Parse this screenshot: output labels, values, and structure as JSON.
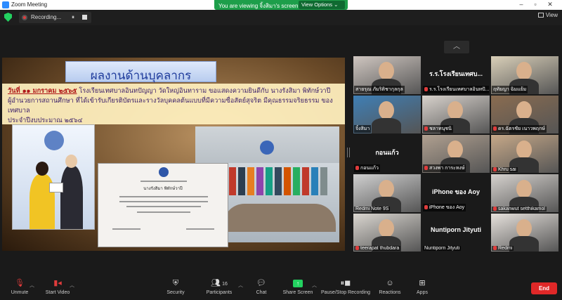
{
  "window": {
    "title": "Zoom Meeting"
  },
  "share_banner": {
    "text": "You are viewing จิ้งสิมา's screen",
    "view_options": "View Options"
  },
  "recording": {
    "label": "Recording...",
    "pause": "⏸"
  },
  "topbar": {
    "view_label": "View"
  },
  "shared_screen": {
    "heading": "ผลงานด้านบุคลากร",
    "date": "วันที่ ๑๑ มกราคม ๒๕๖๕",
    "body_line1": " โรงเรียนเทศบาลอินทปัญญา วัดใหญ่อินทาราม ขอแสดงความยินดีกับ นางรังสิมา พิทักษ์วาปี",
    "body_line2": "ผู้อำนวยการสถานศึกษา ที่ได้เข้ารับเกียรติบัตรและรางวัลบุคคลต้นแบบที่มีความซื่อสัตย์สุจริต มีคุณธรรมจริยธรรม ของเทศบาล",
    "body_line3": "ประจำปีงบประมาณ ๒๕๖๔",
    "cert_name": "นางรังสิมา พิทักษ์วาปี"
  },
  "participants": [
    {
      "name": "สายรุณ ภัมริติชากุลกุล",
      "center": "",
      "video": true,
      "muted": false,
      "color": "#cfc6c0"
    },
    {
      "name": "ร.ร.โรงเรียนเทศบาลอินทปั...",
      "center": "ร.ร.โรงเรียนเทศบ...",
      "video": false,
      "muted": true,
      "color": "#1a1a1a"
    },
    {
      "name": "ฤทัยญา ฉิมแย้ม",
      "center": "",
      "video": true,
      "muted": false,
      "color": "#d9cfb8"
    },
    {
      "name": "จิ้งสิมา",
      "center": "",
      "video": true,
      "muted": false,
      "color": "#3f7fb5",
      "speaking": true
    },
    {
      "name": "ชลาทนุชนิ",
      "center": "",
      "video": true,
      "muted": true,
      "color": "#d8d2cc"
    },
    {
      "name": "ดร.ฉัตรชัย เนาวพฤกษ์",
      "center": "",
      "video": true,
      "muted": true,
      "color": "#8a6c50"
    },
    {
      "name": "กอนแก้ว",
      "center": "กอนแก้ว",
      "video": false,
      "muted": true,
      "color": "#1a1a1a"
    },
    {
      "name": "สวงพา การะหงษ์",
      "center": "",
      "video": true,
      "muted": true,
      "color": "#b0a090"
    },
    {
      "name": "Khru sai",
      "center": "",
      "video": true,
      "muted": true,
      "color": "#c6a888"
    },
    {
      "name": "Redmi Note 9S",
      "center": "",
      "video": true,
      "muted": false,
      "color": "#d0d0d0"
    },
    {
      "name": "iPhone ของ Aoy",
      "center": "iPhone ของ Aoy",
      "video": false,
      "muted": true,
      "color": "#1a1a1a"
    },
    {
      "name": "sakanwut setthikamol",
      "center": "",
      "video": true,
      "muted": true,
      "color": "#d6d2ce"
    },
    {
      "name": "teerapat thubdara",
      "center": "",
      "video": true,
      "muted": true,
      "color": "#dad6d0"
    },
    {
      "name": "Nuntiporn Jityuti",
      "center": "Nuntiporn Jityuti",
      "video": false,
      "muted": false,
      "color": "#1a1a1a"
    },
    {
      "name": "Redmi",
      "center": "",
      "video": true,
      "muted": true,
      "color": "#e6e1dc"
    }
  ],
  "toolbar": {
    "unmute": "Unmute",
    "start_video": "Start Video",
    "security": "Security",
    "participants": "Participants",
    "participants_count": "16",
    "chat": "Chat",
    "share_screen": "Share Screen",
    "pause_recording": "Pause/Stop Recording",
    "reactions": "Reactions",
    "apps": "Apps",
    "end": "End"
  },
  "colors": {
    "accent_green": "#23d160",
    "end_red": "#e02828",
    "speaker_outline": "#f1c40f"
  }
}
